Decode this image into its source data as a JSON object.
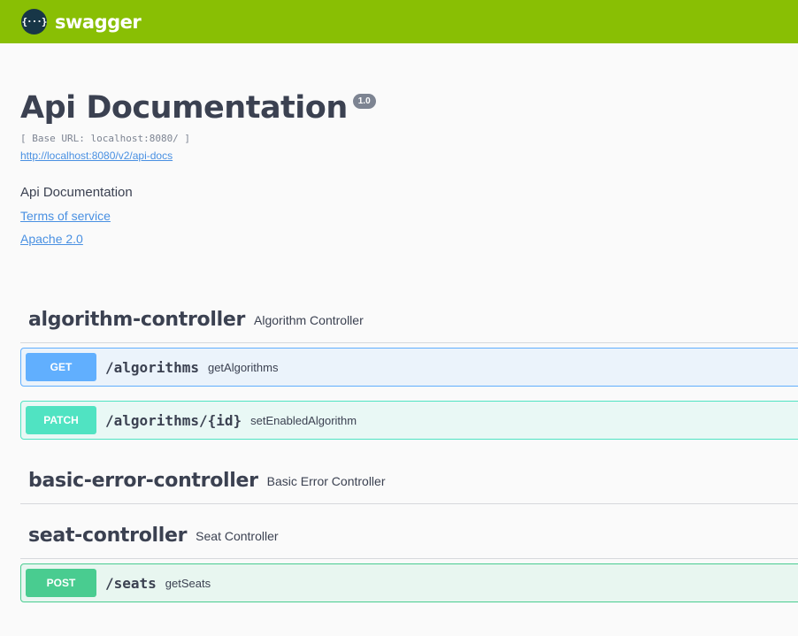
{
  "topbar": {
    "logo_glyph": "{···}",
    "logo_text": "swagger",
    "bg_color": "#89bf04"
  },
  "info": {
    "title": "Api Documentation",
    "version": "1.0",
    "base_url": "[ Base URL: localhost:8080/ ]",
    "spec_url": "http://localhost:8080/v2/api-docs",
    "description": "Api Documentation",
    "terms_link": "Terms of service",
    "license_link": "Apache 2.0"
  },
  "tags": [
    {
      "name": "algorithm-controller",
      "description": "Algorithm Controller",
      "operations": [
        {
          "method": "GET",
          "path": "/algorithms",
          "summary": "getAlgorithms"
        },
        {
          "method": "PATCH",
          "path": "/algorithms/{id}",
          "summary": "setEnabledAlgorithm"
        }
      ]
    },
    {
      "name": "basic-error-controller",
      "description": "Basic Error Controller",
      "operations": []
    },
    {
      "name": "seat-controller",
      "description": "Seat Controller",
      "operations": [
        {
          "method": "POST",
          "path": "/seats",
          "summary": "getSeats"
        }
      ]
    }
  ],
  "colors": {
    "get": "#61affe",
    "patch": "#50e3c2",
    "post": "#49cc90",
    "link": "#4990e2"
  }
}
